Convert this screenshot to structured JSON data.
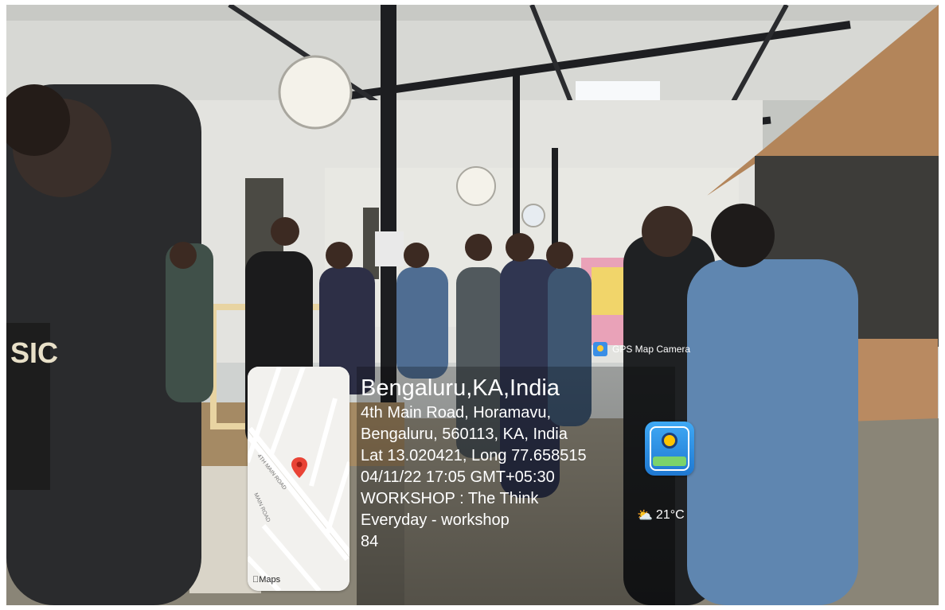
{
  "watermark": {
    "app_badge": "GPS Map Camera",
    "city": "Bengaluru,KA,India",
    "address_line1": "4th Main Road, Horamavu,",
    "address_line2": "Bengaluru, 560113, KA, India",
    "coords": "Lat 13.020421, Long 77.658515",
    "datetime": "04/11/22 17:05 GMT+05:30",
    "note_line1": "WORKSHOP : The Think",
    "note_line2": "Everyday - workshop",
    "note_line3": "84",
    "weather": "21°C",
    "maps_label": "Maps",
    "map_road_1": "4TH MAIN ROAD",
    "map_road_2": "MAIN ROAD"
  },
  "colors": {
    "pin": "#e94335",
    "app_icon": "#2a8ce3"
  }
}
